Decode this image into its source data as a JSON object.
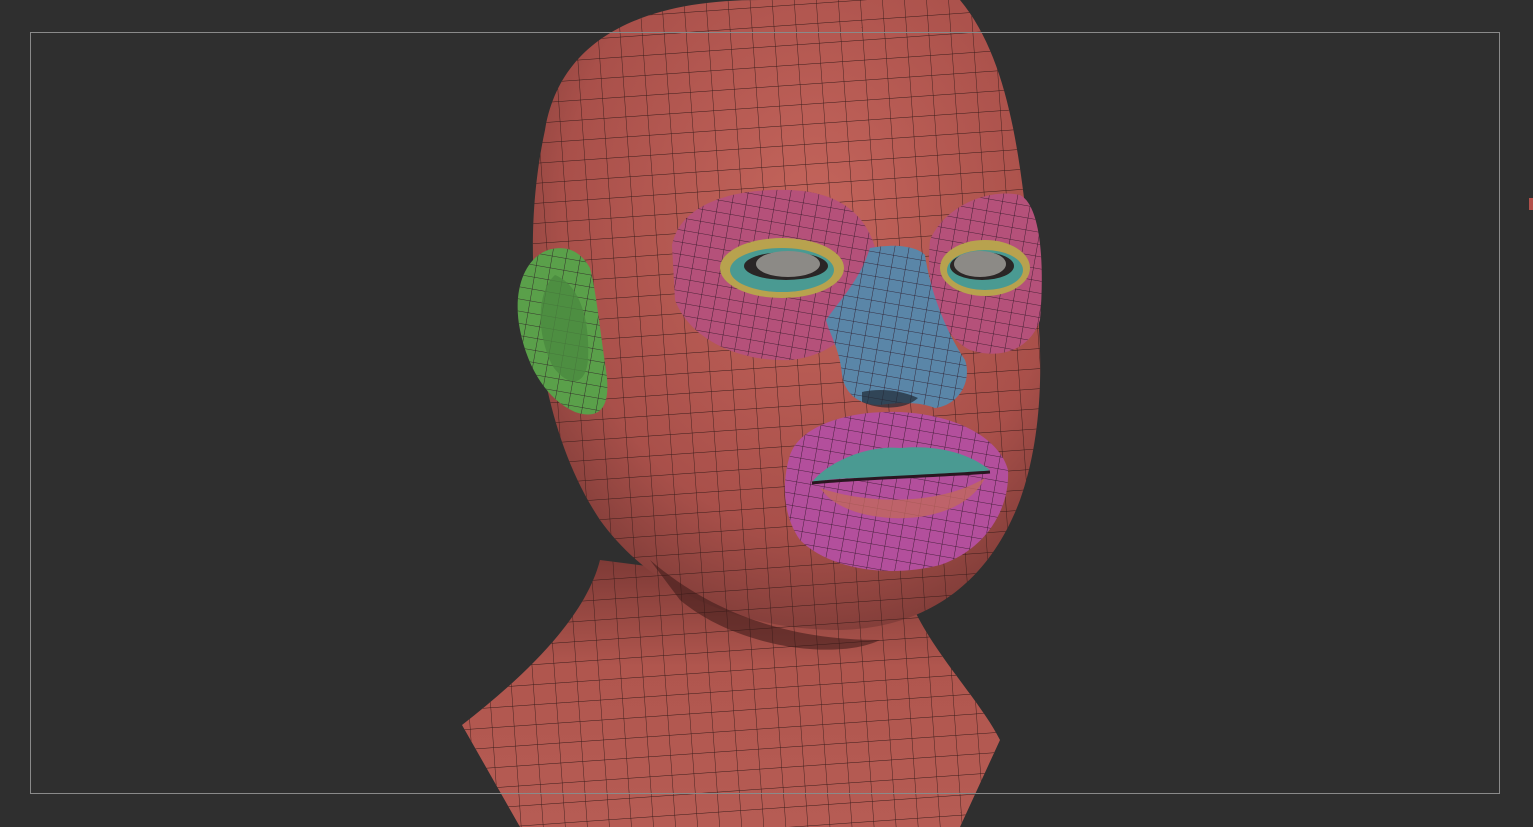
{
  "scene": {
    "model_icon": "polygroup-head-mesh-icon",
    "colors": {
      "background": "#2f2f2f",
      "frame": "#8a8a8a",
      "skin": "#b55a52",
      "skin_dark": "#7e3a36",
      "wire": "#3a1c1a",
      "eye_region": "#b5517a",
      "lips_region": "#b34f9c",
      "nose": "#5a86a8",
      "ear": "#5aa04a",
      "eyelid": "#b8a24e",
      "lip_inner": "#4a9a92",
      "eyeball": "#8c8a86"
    },
    "polygroups": [
      "skin",
      "eye-region-left",
      "eye-region-right",
      "nose",
      "lips",
      "ear"
    ]
  }
}
